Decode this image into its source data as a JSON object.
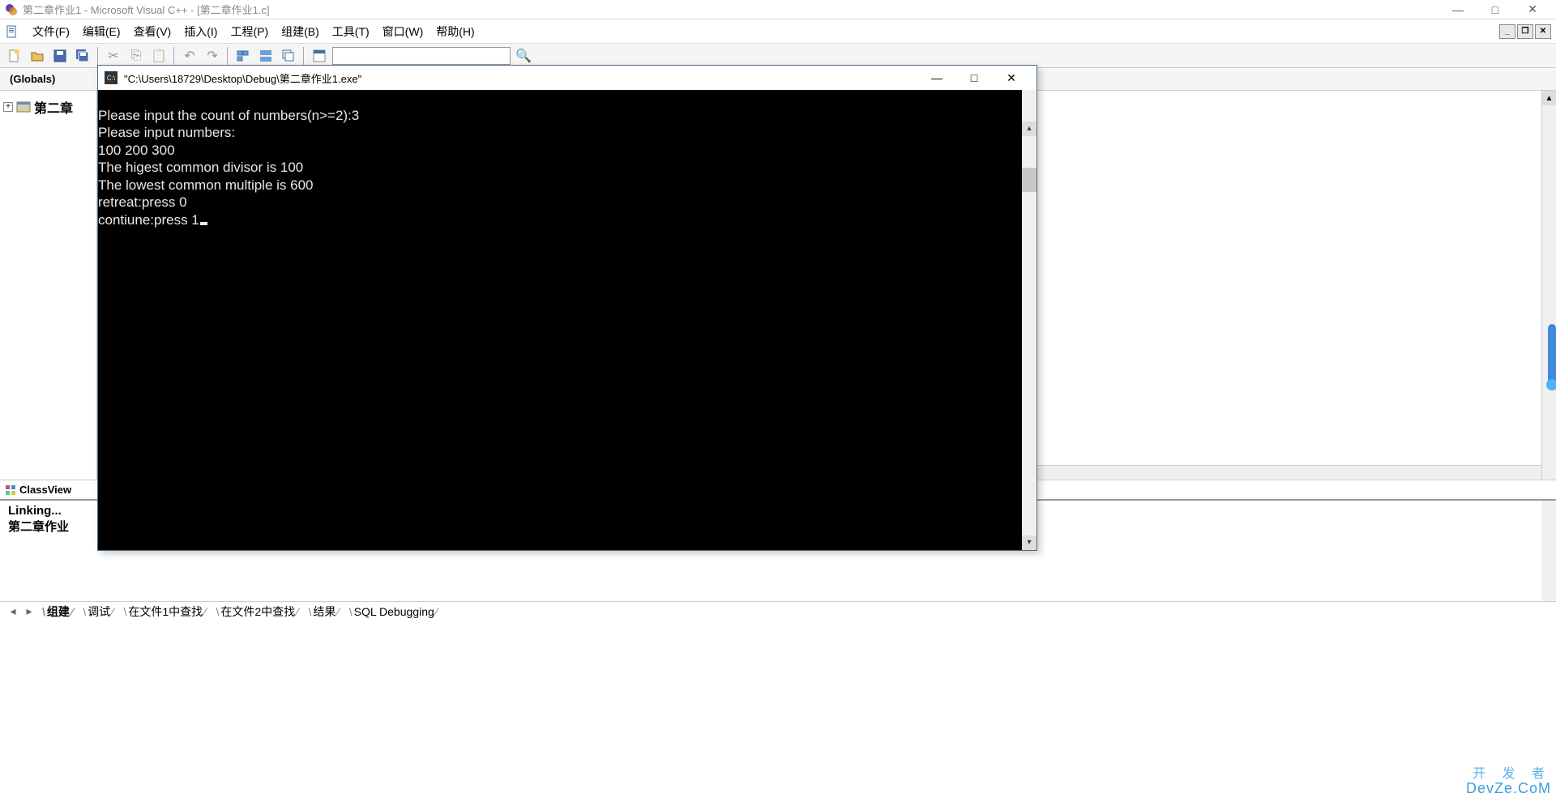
{
  "titlebar": {
    "text": "第二章作业1 - Microsoft Visual C++ - [第二章作业1.c]"
  },
  "window_controls": {
    "minimize": "—",
    "maximize": "□",
    "close": "✕"
  },
  "menus": {
    "file": "文件(F)",
    "edit": "编辑(E)",
    "view": "查看(V)",
    "insert": "插入(I)",
    "project": "工程(P)",
    "build": "组建(B)",
    "tools": "工具(T)",
    "window": "窗口(W)",
    "help": "帮助(H)"
  },
  "mdi_controls": {
    "min": "_",
    "restore": "❐",
    "close": "✕"
  },
  "toolbar2": {
    "globals": "(Globals)"
  },
  "tree": {
    "root": "第二章"
  },
  "classview_tab": "ClassView",
  "output": {
    "line1": "Linking...",
    "line2": "第二章作业"
  },
  "output_tabs": {
    "build": "组建",
    "debug": "调试",
    "find1": "在文件1中查找",
    "find2": "在文件2中查找",
    "results": "结果",
    "sql": "SQL Debugging"
  },
  "console": {
    "title": "\"C:\\Users\\18729\\Desktop\\Debug\\第二章作业1.exe\"",
    "lines": [
      "Please input the count of numbers(n>=2):3",
      "Please input numbers:",
      "100 200 300",
      "The higest common divisor is 100",
      "The lowest common multiple is 600",
      "retreat:press 0",
      "contiune:press 1"
    ]
  },
  "watermark": {
    "top": "开 发 者",
    "bottom": "DevZe.CoM"
  }
}
